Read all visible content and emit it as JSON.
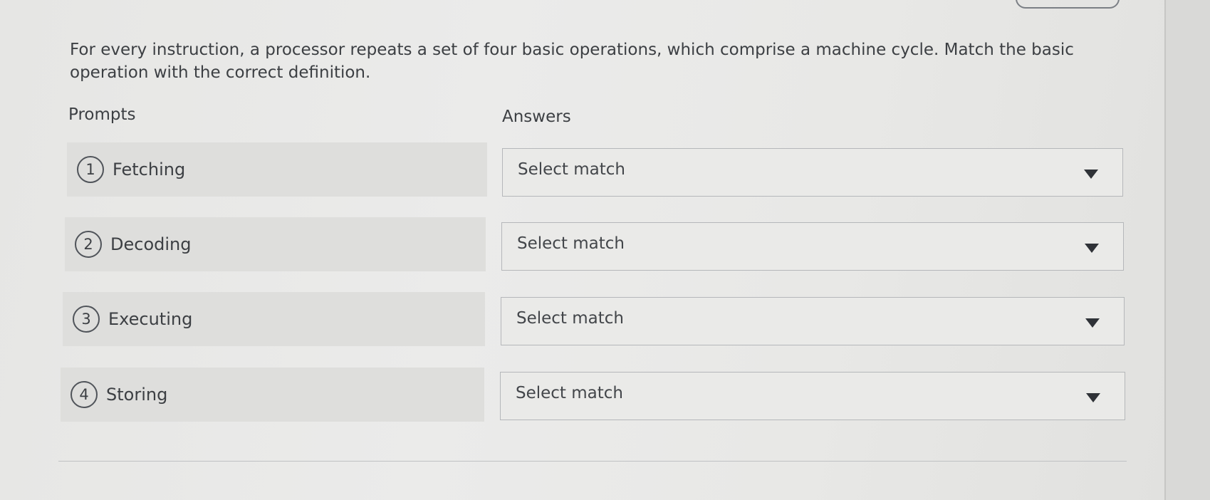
{
  "question": {
    "text": "For every instruction, a processor repeats a set of four basic operations, which comprise a machine cycle. Match the basic operation with the correct definition."
  },
  "headings": {
    "prompts": "Prompts",
    "answers": "Answers"
  },
  "prompts": [
    {
      "number": "1",
      "label": "Fetching"
    },
    {
      "number": "2",
      "label": "Decoding"
    },
    {
      "number": "3",
      "label": "Executing"
    },
    {
      "number": "4",
      "label": "Storing"
    }
  ],
  "answers": [
    {
      "value": "Select match"
    },
    {
      "value": "Select match"
    },
    {
      "value": "Select match"
    },
    {
      "value": "Select match"
    }
  ],
  "icons": {
    "dropdown": "caret-down-icon"
  }
}
